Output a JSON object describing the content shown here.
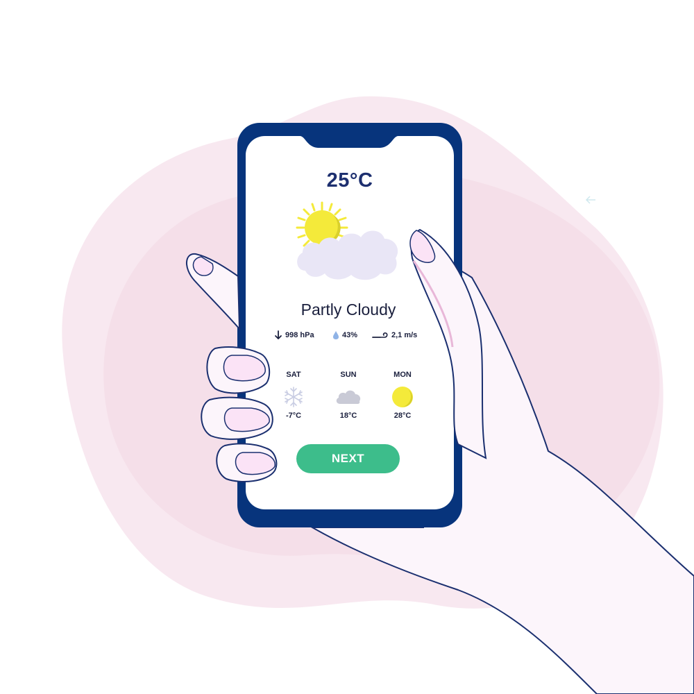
{
  "weather": {
    "temperature": "25°C",
    "condition": "Partly Cloudy",
    "main_icon": "sun-behind-cloud-icon",
    "stats": {
      "pressure": {
        "icon": "arrow-down-icon",
        "value": "998 hPa"
      },
      "humidity": {
        "icon": "droplet-icon",
        "value": "43%"
      },
      "wind": {
        "icon": "wind-icon",
        "value": "2,1 m/s"
      }
    }
  },
  "forecast": [
    {
      "day": "SAT",
      "icon": "snowflake-icon",
      "temp": "-7°C"
    },
    {
      "day": "SUN",
      "icon": "cloud-icon",
      "temp": "18°C"
    },
    {
      "day": "MON",
      "icon": "sun-icon",
      "temp": "28°C"
    }
  ],
  "next_label": "NEXT",
  "colors": {
    "phone_frame": "#07347c",
    "accent_green": "#3dbd8b",
    "sun_yellow": "#f4ea3a",
    "blob_pink": "#f5dde6",
    "skin": "#fcf5fb",
    "nail_pink": "#fbe3f6",
    "text_dark": "#1a1f3d",
    "temp_navy": "#1d2f6f"
  }
}
